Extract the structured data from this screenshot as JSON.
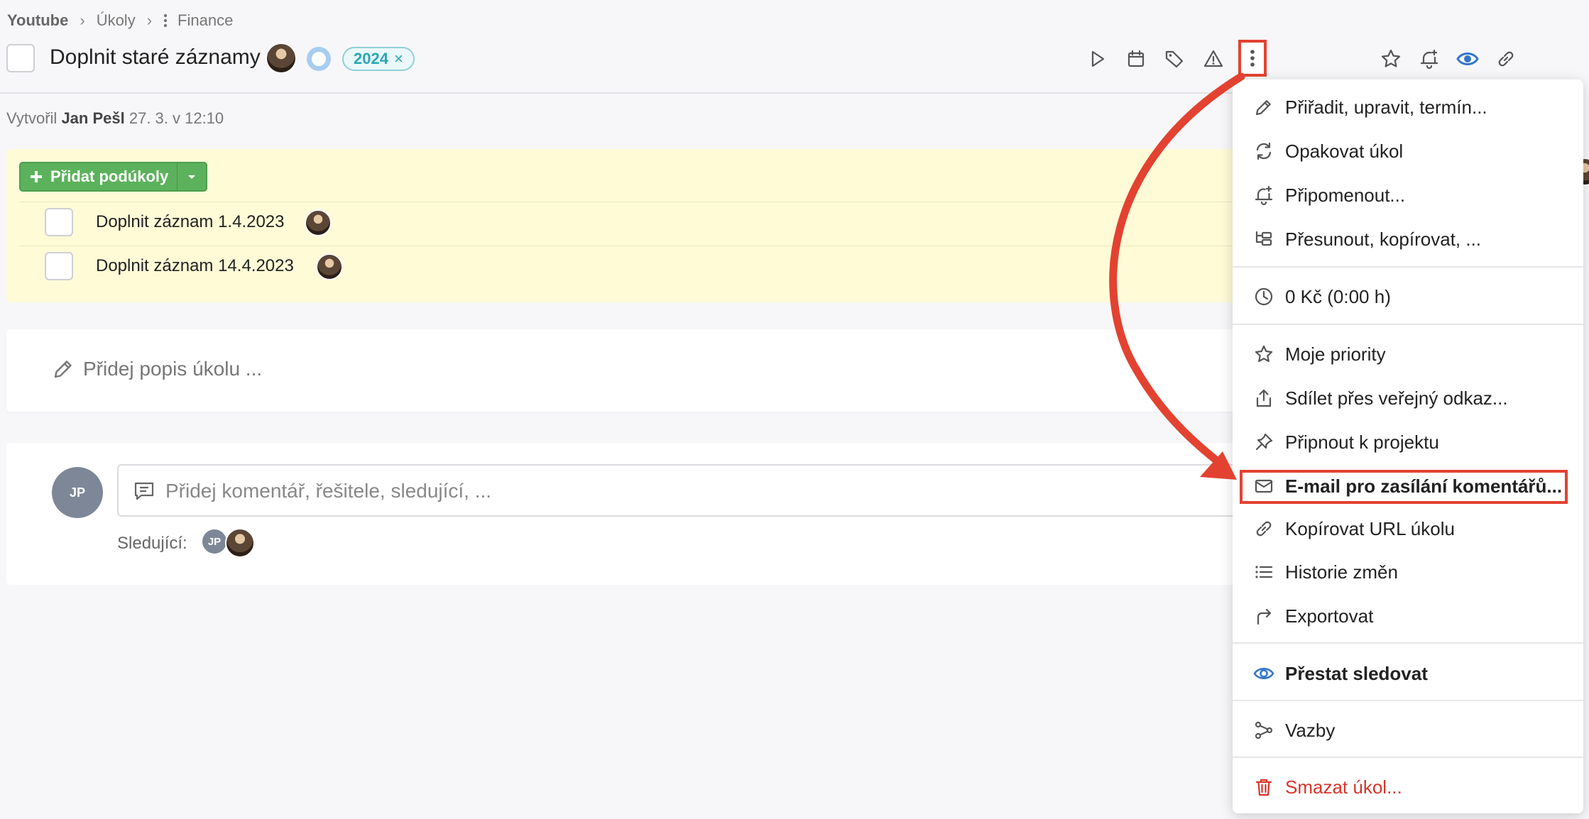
{
  "breadcrumb": {
    "items": [
      "Youtube",
      "Úkoly",
      "Finance"
    ]
  },
  "task": {
    "title": "Doplnit staré záznamy",
    "tag": "2024",
    "tag_remove": "×",
    "created_prefix": "Vytvořil",
    "created_author": "Jan Pešl",
    "created_date": "27. 3. v 12:10"
  },
  "subtasks": {
    "add_button": "Přidat podúkoly",
    "items": [
      {
        "label": "Doplnit záznam 1.4.2023"
      },
      {
        "label": "Doplnit záznam 14.4.2023"
      }
    ]
  },
  "description": {
    "placeholder": "Přidej popis úkolu ..."
  },
  "comments": {
    "avatar_initials": "JP",
    "placeholder": "Přidej komentář, řešitele, sledující, ...",
    "followers_label": "Sledující:",
    "follower_initials": "JP"
  },
  "menu": {
    "items": [
      {
        "label": "Přiřadit, upravit, termín...",
        "icon": "pencil-icon"
      },
      {
        "label": "Opakovat úkol",
        "icon": "repeat-icon"
      },
      {
        "label": "Připomenout...",
        "icon": "bell-plus-icon"
      },
      {
        "label": "Přesunout, kopírovat, ...",
        "icon": "move-icon"
      },
      {
        "label": "0 Kč (0:00 h)",
        "icon": "clock-icon"
      },
      {
        "label": "Moje priority",
        "icon": "star-icon"
      },
      {
        "label": "Sdílet přes veřejný odkaz...",
        "icon": "share-icon"
      },
      {
        "label": "Připnout k projektu",
        "icon": "pin-icon"
      },
      {
        "label": "E-mail pro zasílání komentářů...",
        "icon": "mail-icon"
      },
      {
        "label": "Kopírovat URL úkolu",
        "icon": "link-icon"
      },
      {
        "label": "Historie změn",
        "icon": "list-icon"
      },
      {
        "label": "Exportovat",
        "icon": "export-icon"
      },
      {
        "label": "Přestat sledovat",
        "icon": "eye-icon"
      },
      {
        "label": "Vazby",
        "icon": "relations-icon"
      },
      {
        "label": "Smazat úkol...",
        "icon": "trash-icon"
      }
    ]
  },
  "colors": {
    "accent_green": "#5cb25c",
    "highlight_red": "#e34231",
    "danger": "#d9352b",
    "subtask_bg": "#fffbd7",
    "tag_teal": "#2aa6b5",
    "eye_blue": "#3477c9"
  }
}
